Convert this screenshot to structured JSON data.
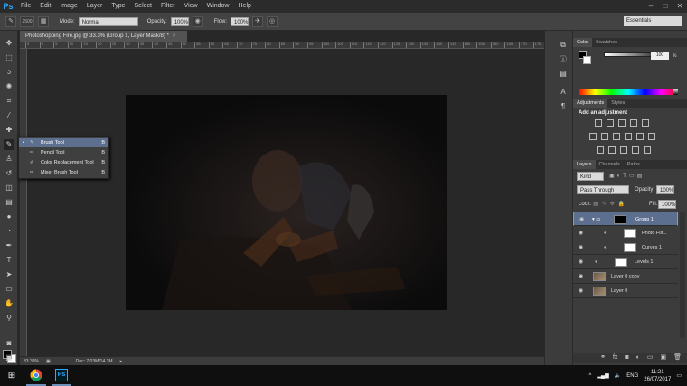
{
  "app": {
    "logo": "Ps"
  },
  "menu": [
    "File",
    "Edit",
    "Image",
    "Layer",
    "Type",
    "Select",
    "Filter",
    "View",
    "Window",
    "Help"
  ],
  "window_controls": [
    "–",
    "□",
    "✕"
  ],
  "options": {
    "brush_size": "2500",
    "mode_label": "Mode:",
    "mode_value": "Normal",
    "opacity_label": "Opacity:",
    "opacity_value": "100%",
    "flow_label": "Flow:",
    "flow_value": "100%",
    "workspace": "Essentials"
  },
  "document": {
    "tab_title": "Photoshopping Fire.jpg @ 33.3% (Group 1, Layer Mask/8) *",
    "close": "×",
    "ruler_ticks": [
      "5",
      "0",
      "5",
      "10",
      "15",
      "20",
      "25",
      "30",
      "35",
      "40",
      "45",
      "50",
      "55",
      "60",
      "65",
      "70",
      "75",
      "80",
      "85",
      "90",
      "95",
      "100",
      "105",
      "110",
      "115",
      "120",
      "125",
      "130",
      "135",
      "140",
      "145",
      "150",
      "155",
      "160",
      "165",
      "170",
      "175"
    ],
    "zoom": "33.33%",
    "doc_size": "Doc: 7.03M/14.1M"
  },
  "flyout": {
    "items": [
      {
        "label": "Brush Tool",
        "key": "B"
      },
      {
        "label": "Pencil Tool",
        "key": "B"
      },
      {
        "label": "Color Replacement Tool",
        "key": "B"
      },
      {
        "label": "Mixer Brush Tool",
        "key": "B"
      }
    ]
  },
  "color_panel": {
    "tabs": [
      "Color",
      "Swatches"
    ],
    "value": "100",
    "unit": "%"
  },
  "adjustments_panel": {
    "tabs": [
      "Adjustments",
      "Styles"
    ],
    "title": "Add an adjustment"
  },
  "layers_panel": {
    "tabs": [
      "Layers",
      "Channels",
      "Paths"
    ],
    "kind": "Kind",
    "blend_mode": "Pass Through",
    "opacity_label": "Opacity:",
    "opacity_value": "100%",
    "lock_label": "Lock:",
    "fill_label": "Fill:",
    "fill_value": "100%",
    "layers": [
      {
        "name": "Group 1"
      },
      {
        "name": "Photo Filt..."
      },
      {
        "name": "Curves 1"
      },
      {
        "name": "Levels 1"
      },
      {
        "name": "Layer 0 copy"
      },
      {
        "name": "Layer 0"
      }
    ]
  },
  "taskbar": {
    "language": "ENG",
    "time": "11:21",
    "date": "26/07/2017",
    "tray_up": "^"
  }
}
